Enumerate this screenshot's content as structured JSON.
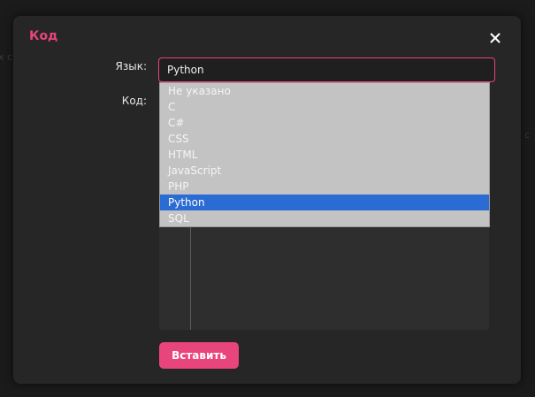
{
  "dialog": {
    "title": "Код",
    "close_icon": "close-icon"
  },
  "form": {
    "language_label": "Язык:",
    "code_label": "Код:",
    "selected_language": "Python",
    "language_options": [
      "Не указано",
      "C",
      "C#",
      "CSS",
      "HTML",
      "JavaScript",
      "PHP",
      "Python",
      "SQL"
    ],
    "selected_index": 7,
    "submit_label": "Вставить"
  },
  "colors": {
    "accent": "#e8457c",
    "dialog_bg": "#262626",
    "dropdown_bg": "#c3c3c3",
    "selected_option_bg": "#2a6bd4"
  }
}
